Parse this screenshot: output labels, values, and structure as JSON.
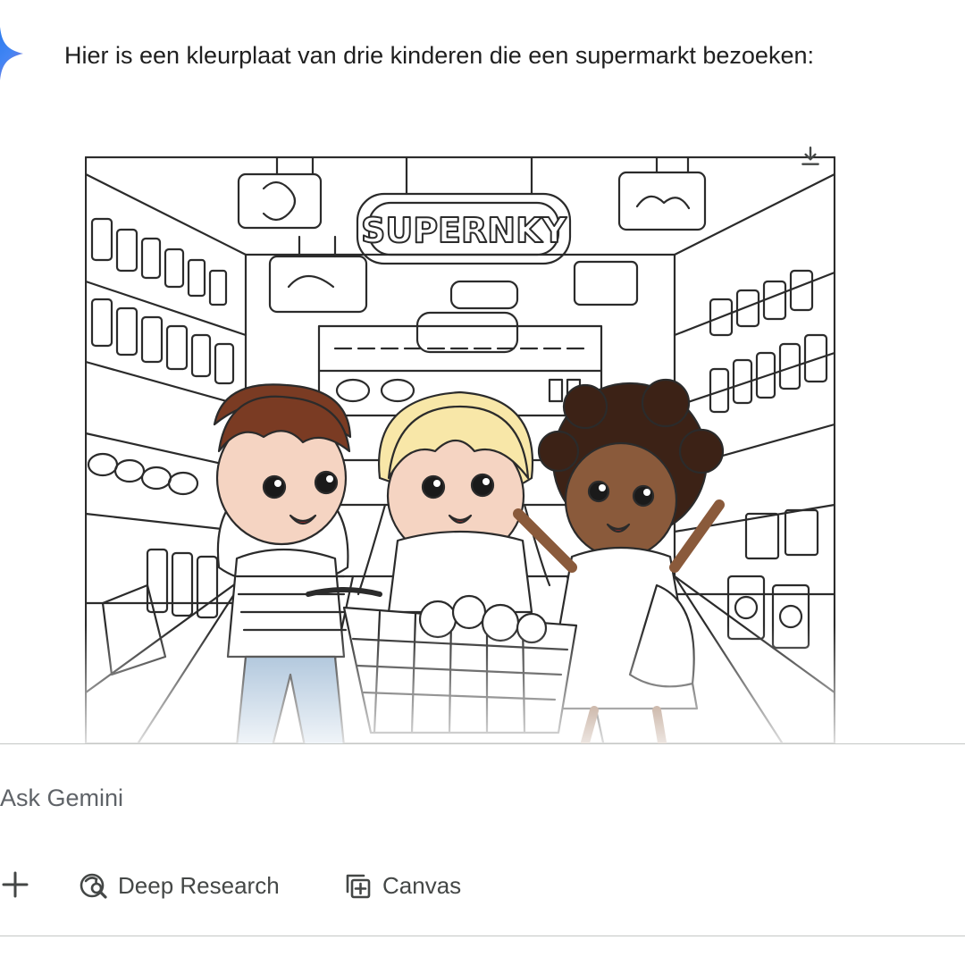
{
  "response": {
    "text": "Hier is een kleurplaat van drie kinderen die een supermarkt bezoeken:"
  },
  "image": {
    "store_sign": "SUPERNKY",
    "download_icon": "download-icon"
  },
  "composer": {
    "placeholder": "Ask Gemini",
    "plus_icon": "plus-icon",
    "tools": [
      {
        "label": "Deep Research",
        "icon": "deep-research-icon"
      },
      {
        "label": "Canvas",
        "icon": "canvas-icon"
      }
    ]
  },
  "colors": {
    "gemini_blue": "#4285f4",
    "text": "#1f1f1f",
    "muted": "#444746",
    "divider": "#c4c7c5"
  }
}
